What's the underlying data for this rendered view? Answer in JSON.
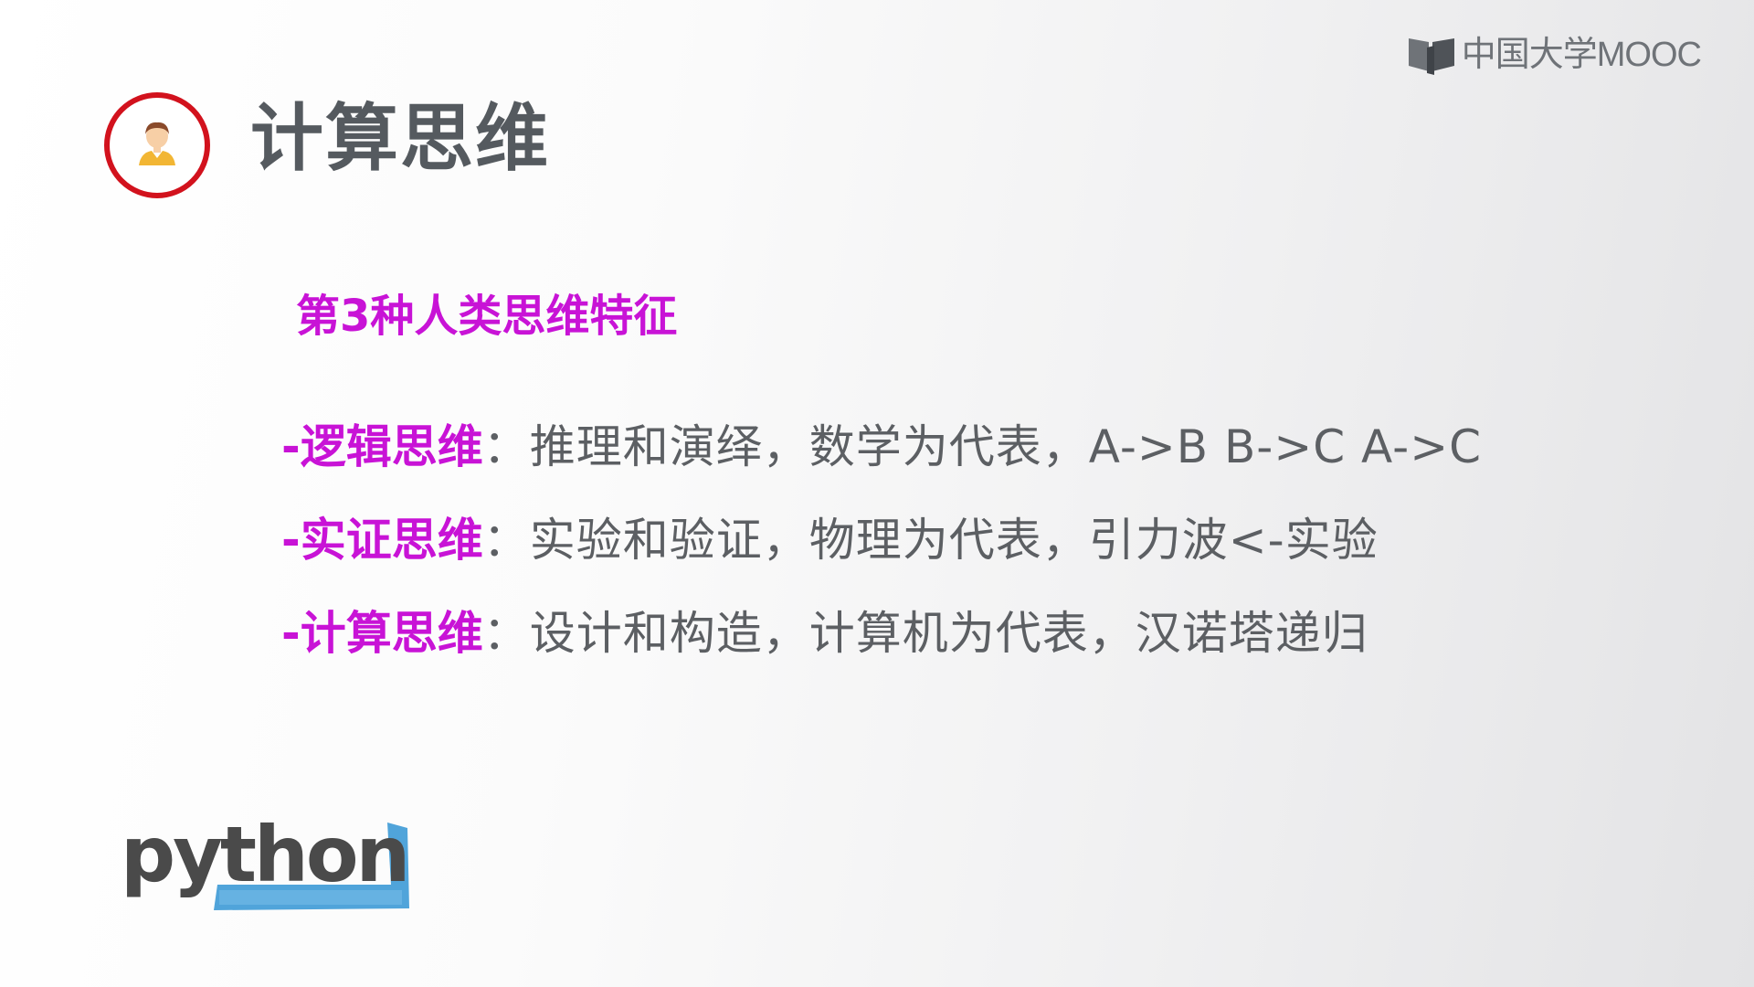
{
  "header": {
    "title": "计算思维",
    "icon": "person-avatar-icon"
  },
  "brand": {
    "logo_text": "中国大学MOOC",
    "logo_icon": "open-book-icon"
  },
  "content": {
    "heading": "第3种人类思维特征",
    "items": [
      {
        "term": "-逻辑思维",
        "desc": "：推理和演绎，数学为代表，A->B B->C A->C"
      },
      {
        "term": "-实证思维",
        "desc": "：实验和验证，物理为代表，引力波<-实验"
      },
      {
        "term": "-计算思维",
        "desc": "：设计和构造，计算机为代表，汉诺塔递归"
      }
    ]
  },
  "footer": {
    "python_logo_text": "python"
  },
  "colors": {
    "accent_magenta": "#c813d6",
    "ring_red": "#d2121d",
    "text_gray": "#5c5f63",
    "python_blue": "#3d9ad6"
  }
}
